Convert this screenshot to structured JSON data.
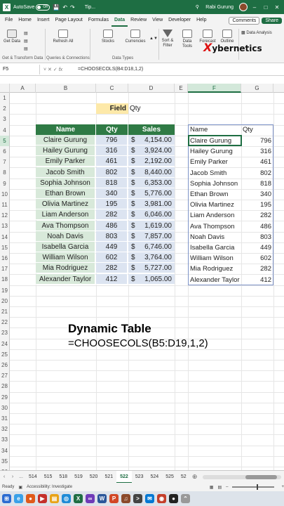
{
  "titlebar": {
    "logo": "X",
    "autosave_label": "AutoSave",
    "autosave_state": "Off",
    "title": "Tip...",
    "user": "Rabi Gurung",
    "icons": [
      "save-icon",
      "undo-icon",
      "redo-icon",
      "search-icon",
      "minimize-icon",
      "maximize-icon",
      "close-icon"
    ]
  },
  "menu": {
    "tabs": [
      "File",
      "Home",
      "Insert",
      "Page Layout",
      "Formulas",
      "Data",
      "Review",
      "View",
      "Developer",
      "Help"
    ],
    "active": "Data",
    "comments": "Comments",
    "share": "Share"
  },
  "ribbon": {
    "get_data": "Get Data",
    "refresh_all": "Refresh All",
    "stocks": "Stocks",
    "currencies": "Currencies",
    "sort_filter": "Sort & Filter",
    "data_tools": "Data Tools",
    "forecast": "Forecast",
    "outline": "Outline",
    "data_analysis": "Data Analysis",
    "group_get_transform": "Get & Transform Data",
    "group_queries": "Queries & Connections",
    "group_data_types": "Data Types",
    "logo_text": "ybernetics",
    "logo_mark": "X"
  },
  "formula_bar": {
    "name_box": "F5",
    "fx": "fx",
    "formula": "=CHOOSECOLS(B4:D18,1,2)"
  },
  "grid": {
    "columns": [
      "A",
      "B",
      "C",
      "D",
      "E",
      "F",
      "G"
    ],
    "selected_column": "F",
    "selected_row": "5",
    "rows": [
      "1",
      "2",
      "3",
      "4",
      "5",
      "6",
      "7",
      "8",
      "9",
      "10",
      "11",
      "12",
      "13",
      "14",
      "15",
      "16",
      "17",
      "18",
      "19",
      "20",
      "21",
      "22",
      "23",
      "24",
      "25",
      "26",
      "27",
      "28",
      "29",
      "30",
      "31",
      "32",
      "33",
      "34",
      "35",
      "36"
    ]
  },
  "field": {
    "label": "Field",
    "value": "Qty"
  },
  "source_table": {
    "headers": [
      "Name",
      "Qty",
      "Sales"
    ],
    "currency": "$",
    "rows": [
      {
        "name": "Claire Gurung",
        "qty": "796",
        "sales": "4,154.00"
      },
      {
        "name": "Hailey Gurung",
        "qty": "316",
        "sales": "3,924.00"
      },
      {
        "name": "Emily Parker",
        "qty": "461",
        "sales": "2,192.00"
      },
      {
        "name": "Jacob Smith",
        "qty": "802",
        "sales": "8,440.00"
      },
      {
        "name": "Sophia Johnson",
        "qty": "818",
        "sales": "6,353.00"
      },
      {
        "name": "Ethan Brown",
        "qty": "340",
        "sales": "5,776.00"
      },
      {
        "name": "Olivia Martinez",
        "qty": "195",
        "sales": "3,981.00"
      },
      {
        "name": "Liam Anderson",
        "qty": "282",
        "sales": "6,046.00"
      },
      {
        "name": "Ava Thompson",
        "qty": "486",
        "sales": "1,619.00"
      },
      {
        "name": "Noah Davis",
        "qty": "803",
        "sales": "7,857.00"
      },
      {
        "name": "Isabella Garcia",
        "qty": "449",
        "sales": "6,746.00"
      },
      {
        "name": "William Wilson",
        "qty": "602",
        "sales": "3,764.00"
      },
      {
        "name": "Mia Rodriguez",
        "qty": "282",
        "sales": "5,727.00"
      },
      {
        "name": "Alexander Taylor",
        "qty": "412",
        "sales": "1,065.00"
      }
    ]
  },
  "result_table": {
    "headers": [
      "Name",
      "Qty"
    ],
    "rows": [
      {
        "name": "Claire Gurung",
        "qty": "796"
      },
      {
        "name": "Hailey Gurung",
        "qty": "316"
      },
      {
        "name": "Emily Parker",
        "qty": "461"
      },
      {
        "name": "Jacob Smith",
        "qty": "802"
      },
      {
        "name": "Sophia Johnson",
        "qty": "818"
      },
      {
        "name": "Ethan Brown",
        "qty": "340"
      },
      {
        "name": "Olivia Martinez",
        "qty": "195"
      },
      {
        "name": "Liam Anderson",
        "qty": "282"
      },
      {
        "name": "Ava Thompson",
        "qty": "486"
      },
      {
        "name": "Noah Davis",
        "qty": "803"
      },
      {
        "name": "Isabella Garcia",
        "qty": "449"
      },
      {
        "name": "William Wilson",
        "qty": "602"
      },
      {
        "name": "Mia Rodriguez",
        "qty": "282"
      },
      {
        "name": "Alexander Taylor",
        "qty": "412"
      }
    ]
  },
  "caption": {
    "title": "Dynamic Table",
    "formula": "=CHOOSECOLS(B5:D19,1,2)"
  },
  "sheet_tabs": {
    "tabs": [
      "514",
      "515",
      "518",
      "519",
      "520",
      "521",
      "522",
      "523",
      "524",
      "525",
      "52"
    ],
    "active": "522",
    "more": "..."
  },
  "status": {
    "ready": "Ready",
    "accessibility": "Accessibility: Investigate"
  },
  "colors": {
    "excel_green": "#1e6e43",
    "header_green": "#2f7a45",
    "field_yellow": "#fde9a9",
    "band_green": "#d8e9da",
    "band_blue": "#dce4f1"
  }
}
